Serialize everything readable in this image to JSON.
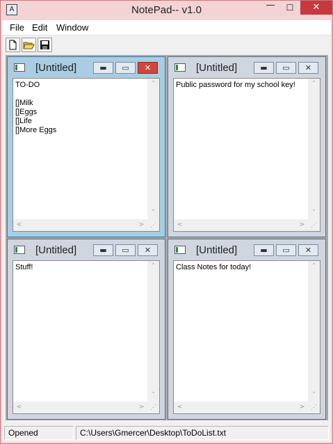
{
  "app": {
    "title": "NotePad-- v1.0",
    "icon": "notepad-icon"
  },
  "window_buttons": {
    "minimize": "—",
    "maximize": "☐",
    "close": "✕"
  },
  "menu": {
    "items": [
      "File",
      "Edit",
      "Window"
    ]
  },
  "toolbar": {
    "buttons": [
      "new-file-icon",
      "open-folder-icon",
      "save-disk-icon"
    ]
  },
  "children": [
    {
      "title": "[Untitled]",
      "text": "TO-DO\n\n[]Milk\n[]Eggs\n[]Life\n[]More Eggs",
      "active": true
    },
    {
      "title": "[Untitled]",
      "text": "Public password for my school key!",
      "active": false
    },
    {
      "title": "[Untitled]",
      "text": "Stuff!",
      "active": false
    },
    {
      "title": "[Untitled]",
      "text": "Class Notes for today!",
      "active": false
    }
  ],
  "child_buttons": {
    "minimize": "▬",
    "maximize": "▭",
    "close": "✕"
  },
  "scroll_arrows": {
    "up": "˄",
    "down": "˅",
    "left": "<",
    "right": ">",
    "grip": "⋰"
  },
  "status": {
    "state": "Opened",
    "path": "C:\\Users\\Gmercer\\Desktop\\ToDoList.txt"
  },
  "colors": {
    "frame": "#f3d3d4",
    "close_red": "#c7393c",
    "active_child": "#a9cde3",
    "inactive_child": "#cfd6e0",
    "mdi_background": "#a9a9a9"
  }
}
